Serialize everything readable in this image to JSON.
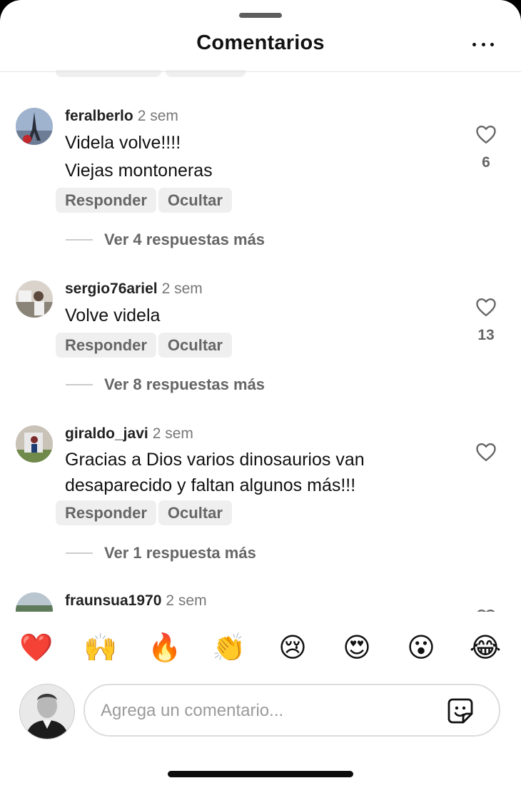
{
  "header": {
    "title": "Comentarios",
    "more_icon": "more-horizontal-icon"
  },
  "comments": [
    {
      "username": "feralberlo",
      "time": "2 sem",
      "text": [
        "Videla volve!!!!",
        "Viejas montoneras"
      ],
      "likes": "6",
      "reply_label": "Responder",
      "hide_label": "Ocultar",
      "view_replies": "Ver 4 respuestas más"
    },
    {
      "username": "sergio76ariel",
      "time": "2 sem",
      "text": [
        "Volve videla"
      ],
      "likes": "13",
      "reply_label": "Responder",
      "hide_label": "Ocultar",
      "view_replies": "Ver 8 respuestas más"
    },
    {
      "username": "giraldo_javi",
      "time": "2 sem",
      "text": [
        "Gracias a Dios varios dinosaurios van",
        "desaparecido y faltan algunos más!!!"
      ],
      "likes": "",
      "reply_label": "Responder",
      "hide_label": "Ocultar",
      "view_replies": "Ver 1 respuesta más"
    },
    {
      "username": "fraunsua1970",
      "time": "2 sem"
    }
  ],
  "reactions": [
    "❤️",
    "🙌",
    "🔥",
    "👏",
    "😢",
    "😍",
    "😮",
    "😂"
  ],
  "composer": {
    "placeholder": "Agrega un comentario...",
    "sticker_icon": "sticker-icon"
  },
  "colors": {
    "background": "#ffffff",
    "secondary_text": "#666666",
    "chip_bg": "#efefef"
  }
}
